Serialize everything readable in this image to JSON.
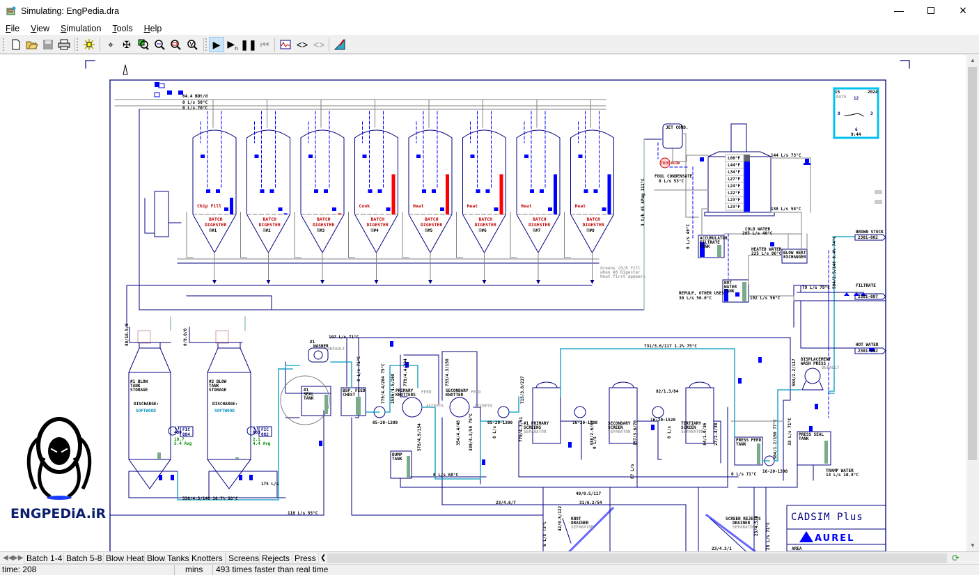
{
  "window": {
    "title": "Simulating: EngPedia.dra",
    "controls": [
      "minimize",
      "maximize",
      "close"
    ]
  },
  "menu": [
    {
      "label": "File",
      "accel": "F",
      "rest": "ile"
    },
    {
      "label": "View",
      "accel": "V",
      "rest": "iew"
    },
    {
      "label": "Simulation",
      "accel": "S",
      "rest": "imulation"
    },
    {
      "label": "Tools",
      "accel": "T",
      "rest": "ools"
    },
    {
      "label": "Help",
      "accel": "H",
      "rest": "elp"
    }
  ],
  "toolbar": {
    "icons": [
      "new-icon",
      "open-icon",
      "save-icon",
      "print-icon",
      "snap-icon",
      "crosshair-icon",
      "move-icon",
      "zoom-fit-icon",
      "zoom-in-icon",
      "zoom-out-icon",
      "zoom-previous-icon",
      "run-icon",
      "run-n-steps-icon",
      "pause-icon",
      "reset-icon",
      "trend-icon",
      "code-icon",
      "code-disabled-icon",
      "drafting-icon"
    ],
    "run_state": "running"
  },
  "clock": {
    "day": "15",
    "year": "2024",
    "date_label": "DATE",
    "n12": "12",
    "n9": "9",
    "n3": "3",
    "n6": "6",
    "time": "9:44"
  },
  "header": {
    "line1": "64.4 BDt/d",
    "line2": "0 L/s 50°C",
    "line3": "0 L/s 70°C"
  },
  "digesters": [
    {
      "id": "#1",
      "status": "Chip Fill",
      "level": 0.3,
      "color": "#0000ff"
    },
    {
      "id": "#2",
      "status": "",
      "level": 0.02,
      "color": "#0000ff"
    },
    {
      "id": "#3",
      "status": "",
      "level": 0.02,
      "color": "#ff0000"
    },
    {
      "id": "#4",
      "status": "Cook",
      "level": 0.72,
      "color": "#ff0000"
    },
    {
      "id": "#5",
      "status": "Heat",
      "level": 0.72,
      "color": "#ff0000"
    },
    {
      "id": "#6",
      "status": "Heat",
      "level": 0.72,
      "color": "#ff0000"
    },
    {
      "id": "#7",
      "status": "Heat",
      "level": 0.72,
      "color": "#0000ff"
    },
    {
      "id": "#8",
      "status": "Heat",
      "level": 0.72,
      "color": "#0000ff"
    }
  ],
  "digester_label": {
    "line1": "BATCH",
    "line2": "DIGESTER"
  },
  "notes": {
    "greens1": "Greens (8/8 fill",
    "greens2": "when #8 Digester",
    "greens3": "Heat first appears"
  },
  "blow_heat": {
    "jet_cond": "JET COND.",
    "trip_blow": "TRIP BLOW",
    "foul_cond": "FOUL CONDENSATE",
    "foul_flow": "0 L/s 53°C",
    "steam_vert": "3 t/h 45 kPag 111°C",
    "stages": [
      "L60°F",
      "L44°F",
      "L34°F",
      "L27°F",
      "L24°F",
      "L22°F",
      "L23°F",
      "L23°F"
    ],
    "flow_top": "144 L/s 73°C",
    "flow_bottom": "138 L/s 58°C",
    "accum": [
      "ACCUMULATOR",
      "FILTRATE",
      "TANK"
    ],
    "accum_flow": "0 L/s 40°C",
    "cold_water": "COLD WATER",
    "cold_flow": "285 L/s 40°C",
    "heated_water": "HEATED WATER",
    "heated_flow": "225 L/s 86°C",
    "exchanger": [
      "BLOW HEAT",
      "EXCHANGER"
    ],
    "hot_tank": [
      "HOT",
      "WATER",
      "TANK"
    ],
    "repulp": "REPULP, OTHER USES",
    "repulp_flow": "30 L/s 56.0°C",
    "hot_flow": "192 L/s 56°C",
    "filtrate_flow": "79 L/s 79°C",
    "brown_stock": "BROWN STOCK",
    "brown_stock_tag": "2301-002",
    "filtrate": "FILTRATE",
    "filtrate_tag": "2301-087",
    "hot_water": "HOT WATER",
    "hot_water_tag": "2301-002",
    "brown_vert": "584/2.5/146 0.4% 74°C"
  },
  "blow_tanks": [
    {
      "name": [
        "#1 BLOW",
        "TANK",
        "STORAGE"
      ],
      "discharge": "DISCHARGE:",
      "wood": "SOFTWOOD",
      "lt": "LT",
      "lt_id": "480",
      "fic": "FIC",
      "fic_id": "084",
      "val1": "10.7",
      "val2": "5.4 Avg",
      "vert": "88/18.5/8"
    },
    {
      "name": [
        "#2 BLOW",
        "TANK",
        "STORAGE"
      ],
      "discharge": "DISCHARGE:",
      "wood": "SOFTWOOD",
      "lt": "LT",
      "lt_id": "083",
      "fic": "FIC",
      "fic_id": "082",
      "val1": "2.1",
      "val2": "4.4 Avg",
      "vert": "0/0.0/0"
    }
  ],
  "washing": {
    "washer": [
      "#1",
      "WASHER"
    ],
    "default": "DEFAULT",
    "seal_tank": [
      "#1",
      "SEAL",
      "TANK"
    ],
    "flow_107": "107 L/s 71°C",
    "flow_175": "175 L/s",
    "loop": "550/4.5/146 10.7% 58°C",
    "flow_118": "118 L/s 55°C",
    "feed_chest": [
      "BSP. FEED",
      "CHEST"
    ],
    "chest_vert": "0 L/s 71°C"
  },
  "screening": {
    "primary_knotters": [
      "PRIMARY",
      "KNOTTERS"
    ],
    "secondary_knotter": [
      "SECONDARY",
      "KNOTTER"
    ],
    "feed": "FEED",
    "accepts": "ACCEPTS",
    "pump1": "05-20-1200",
    "pump2": "05-20-1300",
    "pump3": "16-20-1700",
    "pump4": "16-20-1520",
    "pump5": "16-20-1390",
    "primary_screens": [
      "#1 PRIMARY",
      "SCREENS"
    ],
    "secondary_screen": [
      "SECONDARY",
      "SCREEN"
    ],
    "tertiary_screen": [
      "TERTIARY",
      "SCREEN"
    ],
    "separator": "SEPARATOR",
    "ts_flow": "82/1.3/84",
    "top_flow": "731/3.6/117 1.2% 75°C",
    "dump_tank": [
      "DUMP",
      "TANK"
    ],
    "dump_flow": "0 L/s 68°C",
    "f1": "49/0.5/117",
    "f2": "23/4.6/7",
    "f3": "31/6.2/54",
    "v1": "779/4.4/204 75°C",
    "v2": "1586/4.5/268",
    "v3": "779/4.4/204",
    "v4": "733/4.3/150",
    "v5": "578/4.9/154",
    "v6": "354/4.4/48",
    "v7": "339/4.3/50 75°C",
    "v8": "0 L/s",
    "v9": "770/4.3/61",
    "v10": "715/3.8/217",
    "v11": "338/2.6/87",
    "v12": "157/3.6/70",
    "v13": "84/1.0/36",
    "v14": "27/1.4/38",
    "v15": "87 L/s"
  },
  "press": {
    "wash_press": [
      "DISPLACEMENT",
      "WASH PRESS"
    ],
    "default": "DEFAULT",
    "press_feed": [
      "PRESS FEED",
      "TANK"
    ],
    "press_seal": [
      "PRESS SEAL",
      "TANK"
    ],
    "flow_left": "0 L/s 71°C",
    "tramp": "TRAMP WATER",
    "tramp_flow": "13 L/s 10.8°C",
    "vert1": "584/2.2/117",
    "vert2": "33 L/s 71°C",
    "vert3": "584/1.2/150 77°C"
  },
  "rejects": {
    "knot": [
      "KNOT",
      "DRAINER"
    ],
    "screen": [
      "SCREEN REJECTS",
      "DRAINER"
    ],
    "separator": "SEPARATOR",
    "v1": "42/0.5/122",
    "v2": "6 L/s 73°C",
    "v3": "23/4.5/8",
    "v4": "28 L/s 71°C",
    "f1": "23/4.3/1"
  },
  "title_block": {
    "product": "CADSIM Plus",
    "company": "AUREL",
    "area": "AREA"
  },
  "watermark": {
    "text": "ENGPEDiA.iR"
  },
  "tabs": [
    {
      "label": "Batch 1-4"
    },
    {
      "label": "Batch 5-8"
    },
    {
      "label": "Blow Heat"
    },
    {
      "label": "Blow Tanks"
    },
    {
      "label": "Knotters"
    },
    {
      "label": "Screens"
    },
    {
      "label": "Rejects"
    },
    {
      "label": "Press"
    }
  ],
  "status": {
    "time": "time: 208",
    "units": "mins",
    "speed": "493 times faster than real time"
  }
}
